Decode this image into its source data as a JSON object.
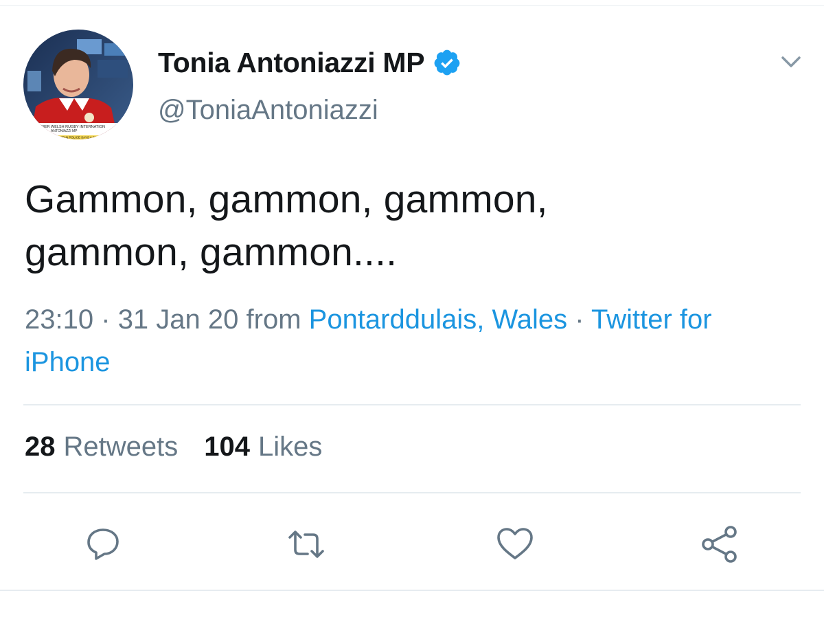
{
  "tweet": {
    "display_name": "Tonia Antoniazzi MP",
    "handle": "@ToniaAntoniazzi",
    "verified": true,
    "text_lines": [
      "Gammon, gammon, gammon,",
      "gammon, gammon...."
    ],
    "time": "23:10",
    "separator": "·",
    "date": "31 Jan 20",
    "from_label": "from",
    "location": "Pontarddulais, Wales",
    "source": "Twitter for iPhone"
  },
  "avatar": {
    "caption_line_1": "R & FORMER WELSH RUGBY INTERNATION",
    "caption_line_2": "ANTONIAZZI MP",
    "caption_line_3": "METROPOLITAN POLICE SAYS A SA"
  },
  "stats": {
    "retweets_count": "28",
    "retweets_label": "Retweets",
    "likes_count": "104",
    "likes_label": "Likes"
  },
  "icons": {
    "verified": "verified-badge-icon",
    "menu": "chevron-down-icon",
    "reply": "reply-icon",
    "retweet": "retweet-icon",
    "like": "heart-icon",
    "share": "share-icon"
  },
  "colors": {
    "text": "#14171a",
    "secondary": "#657786",
    "link": "#1b95e0",
    "verified": "#1da1f2",
    "divider": "#e6ecf0"
  }
}
